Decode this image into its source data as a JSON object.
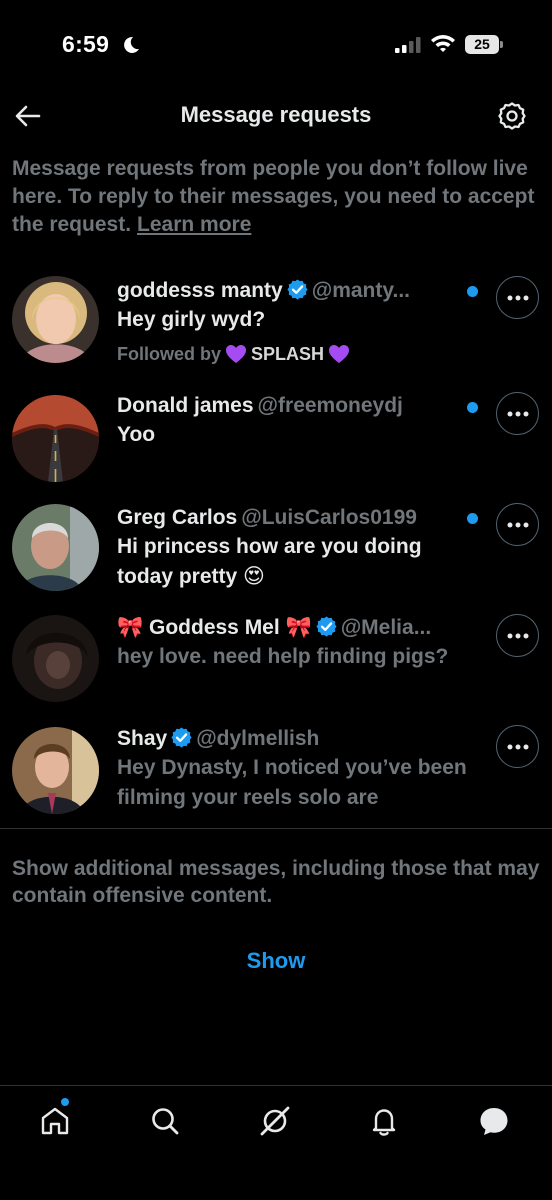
{
  "status_bar": {
    "time": "6:59",
    "battery": "25"
  },
  "header": {
    "title": "Message requests"
  },
  "intro": {
    "text": "Message requests from people you don’t follow live here. To reply to their messages, you need to accept the request.",
    "learn_more": "Learn more"
  },
  "requests": [
    {
      "name": "goddesss manty",
      "verified": true,
      "handle": "@manty...",
      "message": "Hey girly wyd?",
      "followed_by_label": "Followed by",
      "followed_by_name": "SPLASH",
      "unread": true,
      "heart_color": "#a54bf2"
    },
    {
      "name": "Donald james",
      "verified": false,
      "handle": "@freemoneydj",
      "message": "Yoo",
      "unread": true
    },
    {
      "name": "Greg Carlos",
      "verified": false,
      "handle": "@LuisCarlos0199",
      "message": "Hi princess how are you doing today pretty 😍",
      "unread": true
    },
    {
      "name_prefix": "🎀",
      "name": "Goddess Mel",
      "name_suffix": "🎀",
      "verified": true,
      "handle": "@Melia...",
      "message": "hey love. need help finding pigs?",
      "unread": false
    },
    {
      "name": "Shay",
      "verified": true,
      "handle": "@dylmellish",
      "message": "Hey Dynasty, I noticed you’ve been filming your reels solo are",
      "unread": false
    }
  ],
  "more_messages": {
    "text": "Show additional messages, including those that may contain offensive content.",
    "show_label": "Show"
  },
  "tab_bar": {
    "tabs": [
      "home-icon",
      "search-icon",
      "grok-icon",
      "notifications-icon",
      "messages-icon"
    ]
  },
  "colors": {
    "accent": "#1d9bf0",
    "secondary_text": "#71767b",
    "primary_text": "#e7e9ea",
    "background": "#000000"
  }
}
